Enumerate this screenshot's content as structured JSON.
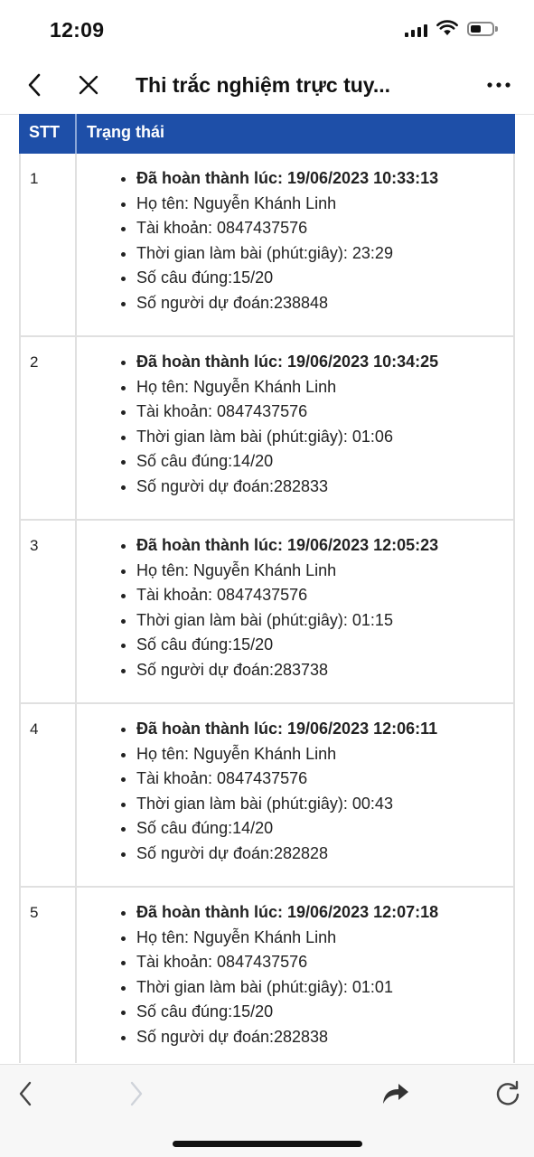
{
  "status_bar": {
    "time": "12:09",
    "icons": [
      "signal-icon",
      "wifi-icon",
      "battery-icon"
    ],
    "battery_level_percent": 50
  },
  "nav_bar": {
    "title": "Thi trắc nghiệm trực tuy...",
    "icons": [
      "chevron-left-icon",
      "close-icon",
      "more-icon"
    ]
  },
  "table": {
    "header_color": "#1e4fa8",
    "columns": [
      "STT",
      "Trạng thái"
    ],
    "rows": [
      {
        "stt": "1",
        "completed": "Đã hoàn thành lúc: 19/06/2023 10:33:13",
        "name": "Họ tên: Nguyễn Khánh Linh",
        "account": "Tài khoản: 0847437576",
        "duration": "Thời gian làm bài (phút:giây): 23:29",
        "correct": "Số câu đúng:15/20",
        "predictors": "Số người dự đoán:238848"
      },
      {
        "stt": "2",
        "completed": "Đã hoàn thành lúc: 19/06/2023 10:34:25",
        "name": "Họ tên: Nguyễn Khánh Linh",
        "account": "Tài khoản: 0847437576",
        "duration": "Thời gian làm bài (phút:giây): 01:06",
        "correct": "Số câu đúng:14/20",
        "predictors": "Số người dự đoán:282833"
      },
      {
        "stt": "3",
        "completed": "Đã hoàn thành lúc: 19/06/2023 12:05:23",
        "name": "Họ tên: Nguyễn Khánh Linh",
        "account": "Tài khoản: 0847437576",
        "duration": "Thời gian làm bài (phút:giây): 01:15",
        "correct": "Số câu đúng:15/20",
        "predictors": "Số người dự đoán:283738"
      },
      {
        "stt": "4",
        "completed": "Đã hoàn thành lúc: 19/06/2023 12:06:11",
        "name": "Họ tên: Nguyễn Khánh Linh",
        "account": "Tài khoản: 0847437576",
        "duration": "Thời gian làm bài (phút:giây): 00:43",
        "correct": "Số câu đúng:14/20",
        "predictors": "Số người dự đoán:282828"
      },
      {
        "stt": "5",
        "completed": "Đã hoàn thành lúc: 19/06/2023 12:07:18",
        "name": "Họ tên: Nguyễn Khánh Linh",
        "account": "Tài khoản: 0847437576",
        "duration": "Thời gian làm bài (phút:giây): 01:01",
        "correct": "Số câu đúng:15/20",
        "predictors": "Số người dự đoán:282838"
      }
    ]
  },
  "bottom_bar": {
    "icons": [
      "back-arrow-icon",
      "forward-arrow-icon",
      "share-icon",
      "reload-icon"
    ]
  }
}
